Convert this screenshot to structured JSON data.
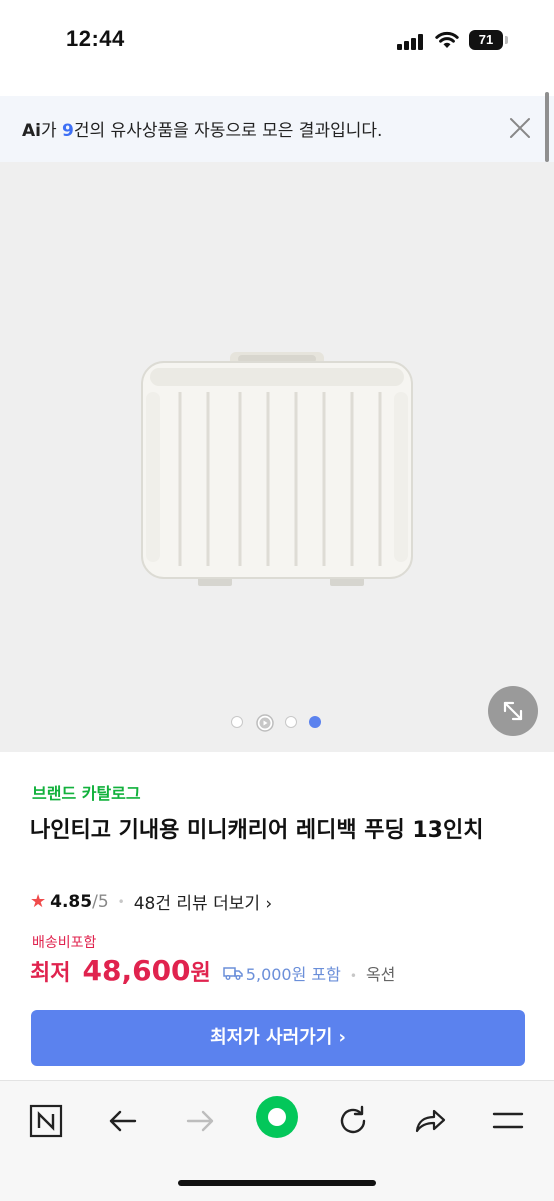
{
  "status_bar": {
    "time": "12:44",
    "battery": "71"
  },
  "ai_banner": {
    "logo": "Ai",
    "text_prefix": "가 ",
    "count": "9",
    "text_suffix": "건의 유사상품을 자동으로 모은 결과입니다."
  },
  "product": {
    "image_dots": 4,
    "active_dot": 3,
    "brand": "브랜드 카탈로그",
    "title": "나인티고 기내용 미니캐리어 레디백 푸딩 13인치",
    "rating": {
      "star": "★",
      "score": "4.85",
      "out_of": "/5",
      "separator": "•",
      "reviews": "48건 리뷰 더보기",
      "chevron": "›"
    },
    "shipping_included": "배송비포함",
    "price_label": "최저",
    "price_value": "48,600",
    "price_unit": "원",
    "shipping_fee": "5,000원 포함",
    "seller_separator": "•",
    "seller": "옥션",
    "buy_button": "최저가 사러가기 ›"
  },
  "colors": {
    "accent_blue": "#5b82ee",
    "price_red": "#e0234e",
    "brand_green": "#12b13c",
    "naver_green": "#03c75a"
  },
  "toolbar": [
    "naver-home-icon",
    "back-arrow-icon",
    "forward-arrow-icon",
    "green-dot-icon",
    "reload-icon",
    "share-icon",
    "menu-icon"
  ]
}
